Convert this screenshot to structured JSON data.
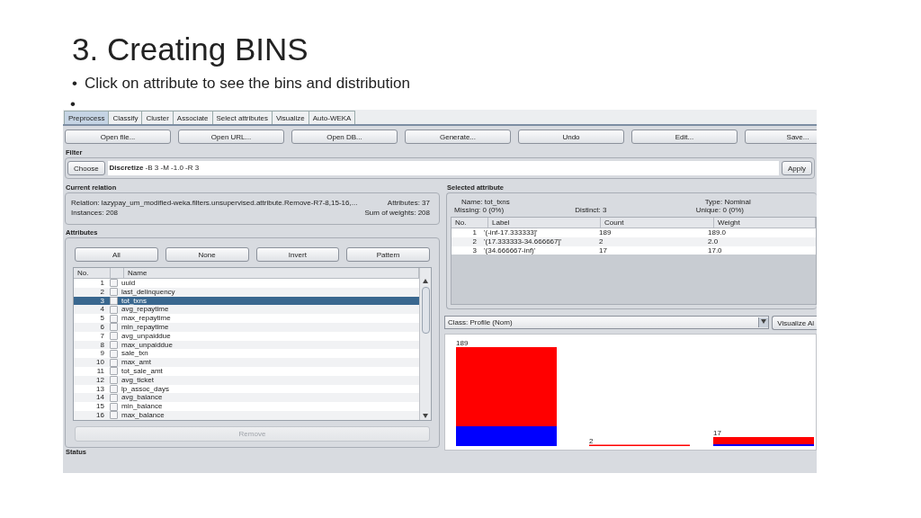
{
  "slide": {
    "title": "3. Creating BINS",
    "bullets": [
      {
        "mark": "•",
        "text": "Click on attribute to see  the bins and distribution"
      },
      {
        "mark": "•"
      }
    ]
  },
  "weka": {
    "tabs": [
      {
        "label": "Preprocess",
        "selected": true
      },
      {
        "label": "Classify",
        "selected": false
      },
      {
        "label": "Cluster",
        "selected": false
      },
      {
        "label": "Associate",
        "selected": false
      },
      {
        "label": "Select attributes",
        "selected": false
      },
      {
        "label": "Visualize",
        "selected": false
      },
      {
        "label": "Auto-WEKA",
        "selected": false
      }
    ],
    "toolbar": [
      "Open file...",
      "Open URL...",
      "Open DB...",
      "Generate...",
      "Undo",
      "Edit...",
      "Save..."
    ],
    "filter": {
      "heading": "Filter",
      "button": "Choose",
      "name": "Discretize",
      "options": "-B 3 -M -1.0 -R 3",
      "apply": "Apply"
    },
    "current_relation": {
      "heading": "Current relation",
      "relation_label": "Relation:",
      "relation": "lazypay_um_modified-weka.filters.unsupervised.attribute.Remove-R7-8,15-16,...",
      "instances_label": "Instances:",
      "instances": "208",
      "attributes_label": "Attributes:",
      "attributes": "37",
      "weights_label": "Sum of weights:",
      "weights": "208"
    },
    "attributes": {
      "heading": "Attributes",
      "buttons": [
        "All",
        "None",
        "Invert",
        "Pattern"
      ],
      "columns": [
        "No.",
        "Name"
      ],
      "rows": [
        {
          "no": "1",
          "name": "uuid",
          "checked": false,
          "selected": false
        },
        {
          "no": "2",
          "name": "last_delinquency",
          "checked": false,
          "selected": false
        },
        {
          "no": "3",
          "name": "tot_txns",
          "checked": false,
          "selected": true
        },
        {
          "no": "4",
          "name": "avg_repaytime",
          "checked": false,
          "selected": false
        },
        {
          "no": "5",
          "name": "max_repaytime",
          "checked": false,
          "selected": false
        },
        {
          "no": "6",
          "name": "min_repaytime",
          "checked": false,
          "selected": false
        },
        {
          "no": "7",
          "name": "avg_unpaiddue",
          "checked": false,
          "selected": false
        },
        {
          "no": "8",
          "name": "max_unpaiddue",
          "checked": false,
          "selected": false
        },
        {
          "no": "9",
          "name": "sale_txn",
          "checked": false,
          "selected": false
        },
        {
          "no": "10",
          "name": "max_amt",
          "checked": false,
          "selected": false
        },
        {
          "no": "11",
          "name": "tot_sale_amt",
          "checked": false,
          "selected": false
        },
        {
          "no": "12",
          "name": "avg_ticket",
          "checked": false,
          "selected": false
        },
        {
          "no": "13",
          "name": "lp_assoc_days",
          "checked": false,
          "selected": false
        },
        {
          "no": "14",
          "name": "avg_balance",
          "checked": false,
          "selected": false
        },
        {
          "no": "15",
          "name": "min_balance",
          "checked": false,
          "selected": false
        },
        {
          "no": "16",
          "name": "max_balance",
          "checked": false,
          "selected": false
        }
      ],
      "remove": {
        "label": "Remove",
        "disabled": true
      }
    },
    "selected_attribute": {
      "heading": "Selected attribute",
      "name_label": "Name:",
      "name": "tot_txns",
      "missing_label": "Missing:",
      "missing": "0 (0%)",
      "distinct_label": "Distinct:",
      "distinct": "3",
      "type_label": "Type:",
      "type": "Nominal",
      "unique_label": "Unique:",
      "unique": "0 (0%)",
      "columns": [
        "No.",
        "Label",
        "Count",
        "Weight"
      ],
      "rows": [
        {
          "no": "1",
          "label": "'(-inf-17.333333]'",
          "count": "189",
          "weight": "189.0"
        },
        {
          "no": "2",
          "label": "'(17.333333-34.666667]'",
          "count": "2",
          "weight": "2.0"
        },
        {
          "no": "3",
          "label": "'(34.666667-inf)'",
          "count": "17",
          "weight": "17.0"
        }
      ]
    },
    "class_selector": "Class: Profile (Nom)",
    "visualize_button": "Visualize Al",
    "histogram": {
      "bar_labels": [
        "189",
        "2",
        "17"
      ]
    },
    "status_heading": "Status"
  }
}
